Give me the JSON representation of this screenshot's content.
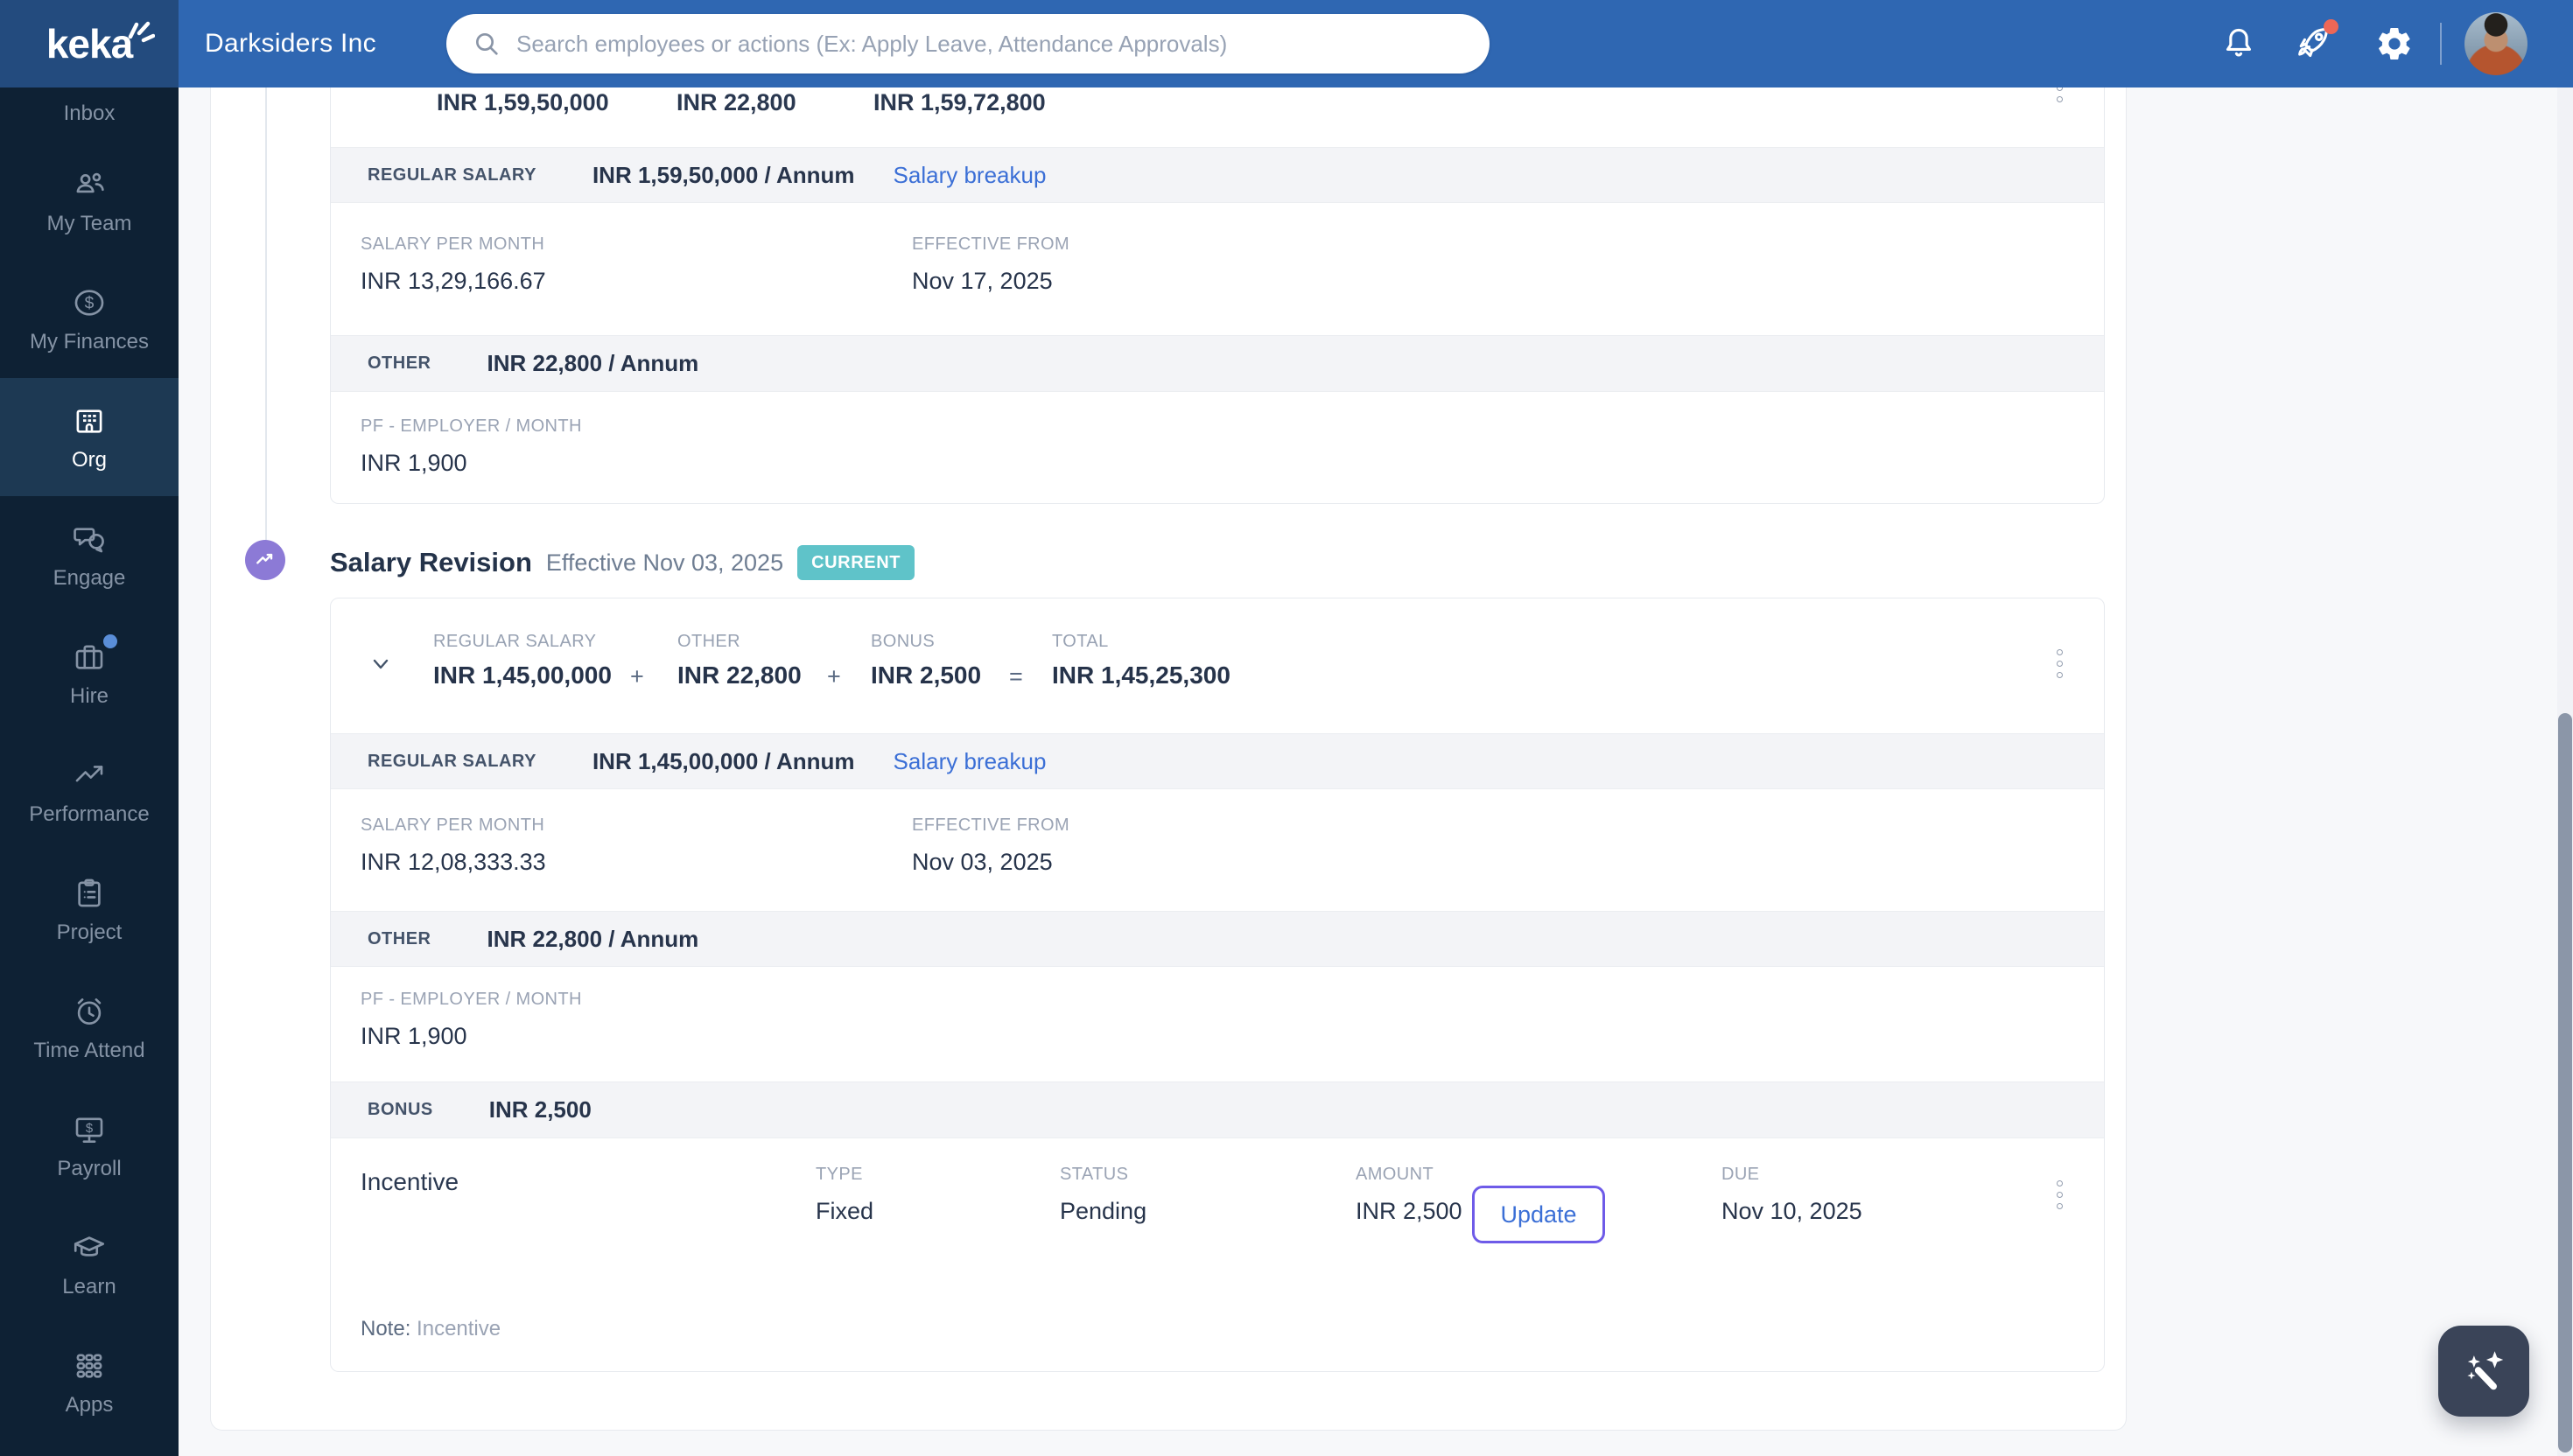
{
  "header": {
    "brand": "keka",
    "company": "Darksiders Inc",
    "search_placeholder": "Search employees or actions (Ex: Apply Leave, Attendance Approvals)"
  },
  "sidebar": {
    "items": [
      {
        "label": "Inbox"
      },
      {
        "label": "My Team"
      },
      {
        "label": "My Finances"
      },
      {
        "label": "Org"
      },
      {
        "label": "Engage"
      },
      {
        "label": "Hire"
      },
      {
        "label": "Performance"
      },
      {
        "label": "Project"
      },
      {
        "label": "Time Attend"
      },
      {
        "label": "Payroll"
      },
      {
        "label": "Learn"
      },
      {
        "label": "Apps"
      }
    ],
    "finance_glyph": "$",
    "payroll_glyph": "$"
  },
  "prev_card": {
    "summary": {
      "regular": "INR 1,59,50,000",
      "other": "INR 22,800",
      "total": "INR 1,59,72,800"
    },
    "regular_band": {
      "label": "REGULAR SALARY",
      "value": "INR 1,59,50,000 / Annum",
      "link": "Salary breakup"
    },
    "salary_month": {
      "label": "SALARY PER MONTH",
      "value": "INR 13,29,166.67"
    },
    "effective": {
      "label": "EFFECTIVE FROM",
      "value": "Nov 17, 2025"
    },
    "other_band": {
      "label": "OTHER",
      "value": "INR 22,800 / Annum"
    },
    "pf": {
      "label": "PF - EMPLOYER / MONTH",
      "value": "INR 1,900"
    }
  },
  "section": {
    "title": "Salary Revision",
    "effective": "Effective Nov 03, 2025",
    "badge": "CURRENT"
  },
  "cur_card": {
    "summary": {
      "regular_label": "REGULAR SALARY",
      "regular": "INR 1,45,00,000",
      "plus1": "+",
      "other_label": "OTHER",
      "other": "INR 22,800",
      "plus2": "+",
      "bonus_label": "BONUS",
      "bonus": "INR 2,500",
      "equals": "=",
      "total_label": "TOTAL",
      "total": "INR 1,45,25,300"
    },
    "regular_band": {
      "label": "REGULAR SALARY",
      "value": "INR 1,45,00,000 / Annum",
      "link": "Salary breakup"
    },
    "salary_month": {
      "label": "SALARY PER MONTH",
      "value": "INR 12,08,333.33"
    },
    "effective": {
      "label": "EFFECTIVE FROM",
      "value": "Nov 03, 2025"
    },
    "other_band": {
      "label": "OTHER",
      "value": "INR 22,800 / Annum"
    },
    "pf": {
      "label": "PF - EMPLOYER / MONTH",
      "value": "INR 1,900"
    },
    "bonus_band": {
      "label": "BONUS",
      "value": "INR 2,500"
    },
    "incentive": {
      "name": "Incentive",
      "type_label": "TYPE",
      "type_value": "Fixed",
      "status_label": "STATUS",
      "status_value": "Pending",
      "amount_label": "AMOUNT",
      "amount_value": "INR 2,500",
      "update_label": "Update",
      "due_label": "DUE",
      "due_value": "Nov 10, 2025",
      "note_label": "Note:",
      "note_value": "Incentive"
    }
  },
  "colors": {
    "header_blue": "#2f67b2",
    "brand_navy": "#234b7e",
    "sidebar_navy": "#0e2134",
    "active_item_navy": "#1d3953",
    "badge_teal": "#5fc3c9",
    "link_blue": "#3b6fd6",
    "focus_violet": "#6e5be8",
    "timeline_purple": "#8c7ad6",
    "notification_red": "#ed6757",
    "fab_slate": "#3a4458"
  }
}
